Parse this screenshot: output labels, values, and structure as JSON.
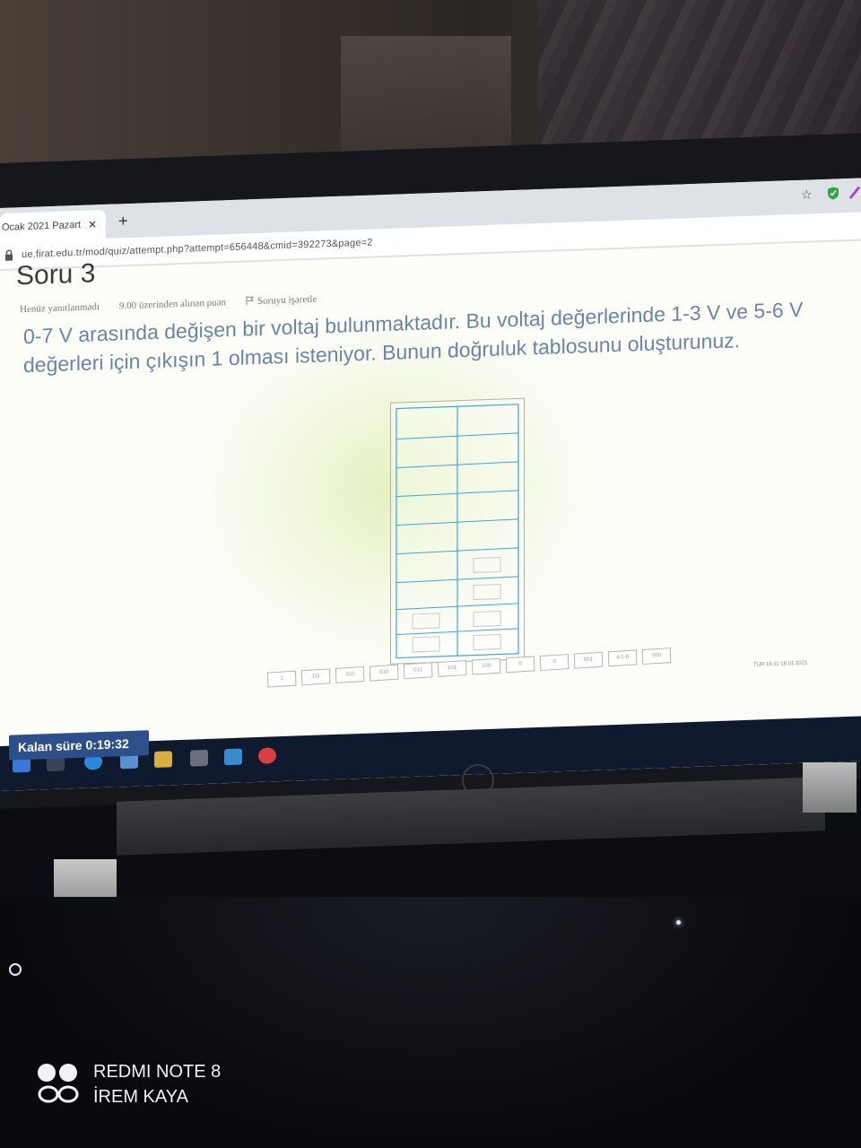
{
  "browser": {
    "tab_title": "Ocak 2021 Pazart",
    "tab_close": "✕",
    "new_tab": "+",
    "url": "ue.firat.edu.tr/mod/quiz/attempt.php?attempt=656448&cmid=392273&page=2"
  },
  "quiz": {
    "question_header": "Soru 3",
    "status": "Henüz yanıtlanmadı",
    "points": "9.00 üzerinden alınan puan",
    "flag_label": "Soruyu işaretle",
    "question_text": "0-7 V arasında değişen bir voltaj bulunmaktadır. Bu voltaj değerlerinde 1-3 V ve 5-6 V değerleri için çıkışın 1 olması isteniyor. Bunun doğruluk tablosunu oluşturunuz.",
    "answer_options": [
      "1",
      "111",
      "110",
      "010",
      "011",
      "101",
      "100",
      "0",
      "0",
      "001",
      "4-5-6",
      "000"
    ],
    "timer_label": "Kalan süre",
    "timer_value": "0:19:32"
  },
  "tray": {
    "lang": "TUR",
    "time": "16:11",
    "date": "18.01.2021"
  },
  "watermark": {
    "device": "REDMI NOTE 8",
    "author": "İREM KAYA"
  },
  "colors": {
    "question_text": "#6a86a6",
    "timer_bg": "#2d4f8a",
    "taskbar_bg": "#0f1a2e",
    "grid_lines": "#3aa7d8"
  }
}
